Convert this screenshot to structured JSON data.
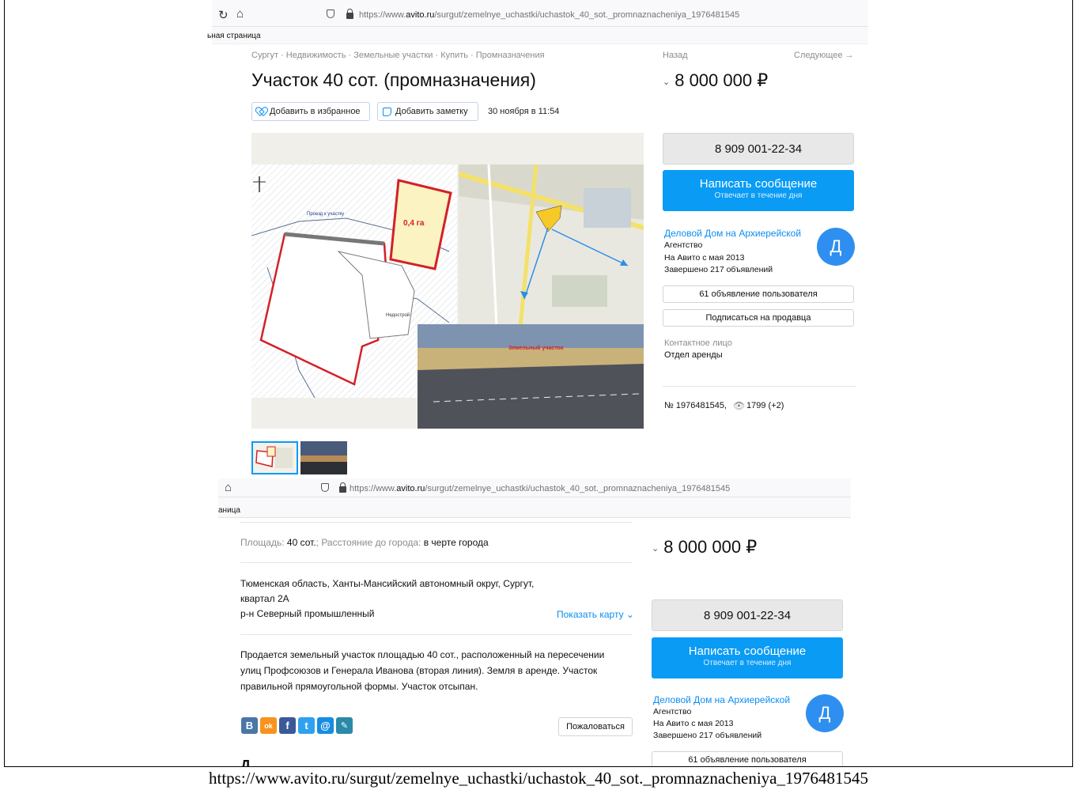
{
  "caption": "https://www.avito.ru/surgut/zemelnye_uchastki/uchastok_40_sot._promnaznacheniya_1976481545",
  "top": {
    "chrome": {
      "url_prefix": "https://www.",
      "url_domain": "avito.ru",
      "url_rest": "/surgut/zemelnye_uchastki/uchastok_40_sot._promnaznacheniya_1976481545",
      "bookmark": "ьная страница"
    },
    "breadcrumbs": "Сургут · Недвижимость · Земельные участки · Купить · Промназначения",
    "back": "Назад",
    "next": "Следующее →",
    "title": "Участок 40 сот. (промназначения)",
    "price": "8 000 000 ₽",
    "favorite": "Добавить в избранное",
    "note": "Добавить заметку",
    "date": "30 ноября в 11:54",
    "photo_labels": {
      "area": "0,4 га",
      "road": "Проезд к участку",
      "building": "Недострой",
      "plot": "Земельный участок"
    },
    "phone": "8 909 001-22-34",
    "message": "Написать сообщение",
    "message_sub": "Отвечает в течение дня",
    "seller": {
      "name": "Деловой Дом на Архиерейской",
      "type": "Агентство",
      "since": "На Авито с мая 2013",
      "completed": "Завершено 217 объявлений",
      "avatar": "Д"
    },
    "listings": "61 объявление пользователя",
    "subscribe": "Подписаться на продавца",
    "contact_label": "Контактное лицо",
    "contact_value": "Отдел аренды",
    "ad_number": "№ 1976481545,",
    "views": "1799 (+2)"
  },
  "bottom": {
    "chrome": {
      "url_prefix": "https://www.",
      "url_domain": "avito.ru",
      "url_rest": "/surgut/zemelnye_uchastki/uchastok_40_sot._promnaznacheniya_1976481545",
      "bookmark": "аница"
    },
    "params": {
      "area_label": "Площадь:",
      "area_value": "40 сот.",
      "distance_label": "; Расстояние до города:",
      "distance_value": "в черте города"
    },
    "address_line1": "Тюменская область, Ханты-Мансийский автономный округ, Сургут,",
    "address_line2": "квартал 2А",
    "district": "р-н Северный промышленный",
    "show_map": "Показать карту",
    "description_line1": "Продается земельный участок площадью 40 сот., расположенный на пересечении",
    "description_line2": "улиц Профсоюзов и Генерала Иванова (вторая линия). Земля в аренде. Участок",
    "description_line3": "правильной прямоугольной формы. Участок отсыпан.",
    "report": "Пожаловаться",
    "social": [
      "В",
      "ok",
      "f",
      "t",
      "@",
      "✎"
    ],
    "price": "8 000 000 ₽",
    "phone": "8 909 001-22-34",
    "message": "Написать сообщение",
    "message_sub": "Отвечает в течение дня",
    "seller": {
      "name": "Деловой Дом на Архиерейской",
      "type": "Агентство",
      "since": "На Авито с мая 2013",
      "completed": "Завершено 217 объявлений",
      "avatar": "Д"
    },
    "listings": "61 объявление пользователя",
    "cut_heading": "Д"
  },
  "colors": {
    "accent": "#0a9bf5",
    "link": "#0a8ef2",
    "plot_red": "#d42026",
    "plot_fill": "#fbf3c2"
  }
}
